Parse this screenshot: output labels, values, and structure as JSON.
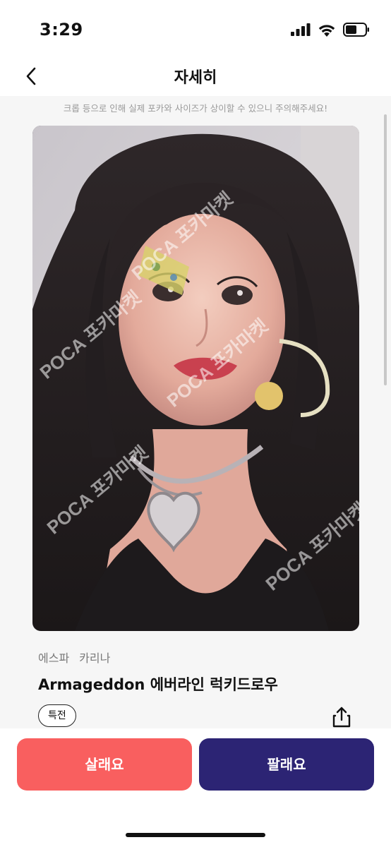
{
  "status_bar": {
    "time": "3:29",
    "signal_icon": "cellular-signal-icon",
    "wifi_icon": "wifi-icon",
    "battery_icon": "battery-icon"
  },
  "nav": {
    "title": "자세히",
    "back_icon": "chevron-left-icon"
  },
  "notice": "크롭 등으로 인해 실제 포카와 사이즈가 상이할 수 있으니 주의해주세요!",
  "photo": {
    "watermark": "POCA 포카마켓"
  },
  "item": {
    "group": "에스파",
    "member": "카리나",
    "title": "Armageddon 에버라인 럭키드로우",
    "tag": "특전",
    "share_icon": "share-icon"
  },
  "actions": {
    "buy_label": "살래요",
    "sell_label": "팔래요"
  },
  "colors": {
    "buy": "#f95f5f",
    "sell": "#2c2474",
    "content_bg": "#f6f6f6"
  }
}
